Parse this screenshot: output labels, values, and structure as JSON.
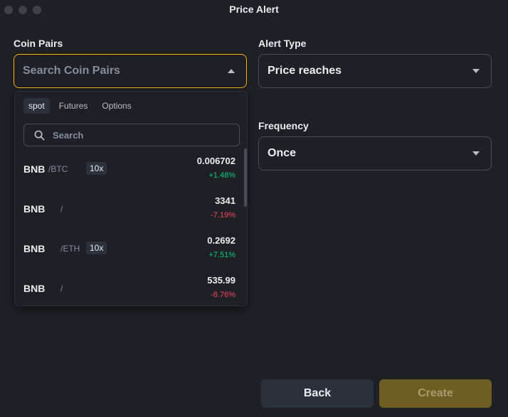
{
  "window": {
    "title": "Price Alert"
  },
  "coin_pairs": {
    "label": "Coin Pairs",
    "placeholder": "Search Coin Pairs",
    "dropdown": {
      "tabs": [
        "spot",
        "Futures",
        "Options"
      ],
      "active_tab": "spot",
      "search_placeholder": "Search",
      "items": [
        {
          "base": "BNB",
          "quote": "/BTC",
          "leverage": "10x",
          "price": "0.006702",
          "change": "+1.48%",
          "direction": "up"
        },
        {
          "base": "BNB",
          "quote": "/",
          "leverage": "",
          "price": "3341",
          "change": "-7.19%",
          "direction": "down"
        },
        {
          "base": "BNB",
          "quote": "/ETH",
          "leverage": "10x",
          "price": "0.2692",
          "change": "+7.51%",
          "direction": "up"
        },
        {
          "base": "BNB",
          "quote": "/",
          "leverage": "",
          "price": "535.99",
          "change": "-8.76%",
          "direction": "down"
        }
      ]
    }
  },
  "alert_type": {
    "label": "Alert Type",
    "value": "Price reaches"
  },
  "frequency": {
    "label": "Frequency",
    "value": "Once"
  },
  "buttons": {
    "back": "Back",
    "create": "Create"
  },
  "colors": {
    "accent": "#f0b90b",
    "up": "#0ecb81",
    "down": "#f6465d",
    "background": "#1e2026"
  },
  "icons": [
    "close-dot-icon",
    "minimize-dot-icon",
    "zoom-dot-icon",
    "caret-up-icon",
    "caret-down-icon",
    "search-icon"
  ]
}
